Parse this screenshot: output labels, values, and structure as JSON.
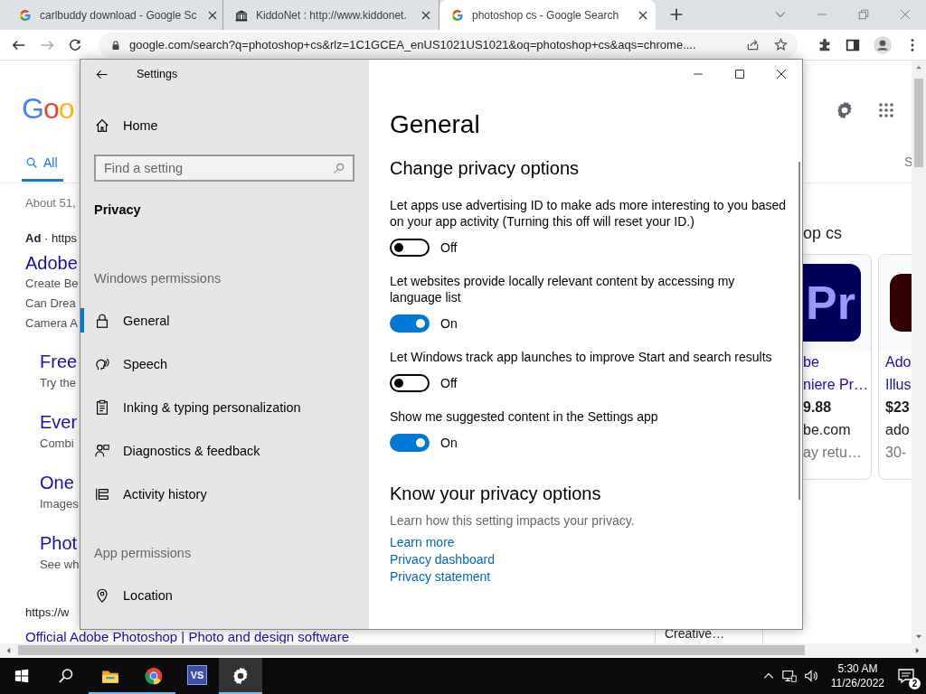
{
  "browser": {
    "tabs": [
      {
        "title": "carlbuddy download - Google Sc",
        "selected": false
      },
      {
        "title": "KiddoNet : http://www.kiddonet.",
        "selected": false
      },
      {
        "title": "photoshop cs - Google Search",
        "selected": true
      }
    ],
    "address": "google.com/search?q=photoshop+cs&rlz=1C1GCEA_enUS1021US1021&oq=photoshop+cs&aqs=chrome...."
  },
  "page": {
    "left": [
      {
        "kind": "logo",
        "text": "Goo"
      },
      {
        "kind": "tab",
        "text": "All",
        "selected": true
      },
      {
        "kind": "meta",
        "text": "About 51,"
      },
      {
        "kind": "ad",
        "text": "**Ad** · https"
      },
      {
        "kind": "title",
        "text": "Adobe"
      },
      {
        "kind": "snippet",
        "text": "Create Be"
      },
      {
        "kind": "snippet",
        "text": "Can Drea"
      },
      {
        "kind": "snippet",
        "text": "Camera A"
      },
      {
        "kind": "sitelink",
        "text": "Free"
      },
      {
        "kind": "sitedesc",
        "text": "Try the"
      },
      {
        "kind": "sitelink",
        "text": "Ever"
      },
      {
        "kind": "sitedesc",
        "text": "Combi"
      },
      {
        "kind": "sitelink",
        "text": "One"
      },
      {
        "kind": "sitedesc",
        "text": "Images"
      },
      {
        "kind": "sitelink",
        "text": "Phot"
      },
      {
        "kind": "sitedesc",
        "text": "See wh"
      },
      {
        "kind": "url",
        "text": "https://w"
      },
      {
        "kind": "result",
        "text": "Official Adobe Photoshop | Photo and design software"
      }
    ],
    "right": {
      "tab_fragment": "S",
      "section_title": "op cs",
      "cards": [
        {
          "icon_text": "Pr",
          "lines": [
            {
              "kind": "link",
              "text": "be"
            },
            {
              "kind": "link",
              "text": "niere Pr…"
            },
            {
              "kind": "price",
              "text": "9.88"
            },
            {
              "kind": "source",
              "text": "be.com"
            },
            {
              "kind": "note",
              "text": "ay retu…"
            }
          ]
        },
        {
          "lines": [
            {
              "kind": "link",
              "text": "Ado"
            },
            {
              "kind": "link",
              "text": "Illus"
            },
            {
              "kind": "price",
              "text": "$23"
            },
            {
              "kind": "source",
              "text": "ado"
            },
            {
              "kind": "note",
              "text": "30-"
            }
          ]
        }
      ]
    },
    "bottom_card": "Creative…"
  },
  "settings": {
    "title": "Settings",
    "home": "Home",
    "search_placeholder": "Find a setting",
    "section": "Privacy",
    "groups": [
      {
        "label": "Windows permissions",
        "items": [
          {
            "label": "General",
            "selected": true
          },
          {
            "label": "Speech",
            "selected": false
          },
          {
            "label": "Inking & typing personalization",
            "selected": false
          },
          {
            "label": "Diagnostics & feedback",
            "selected": false
          },
          {
            "label": "Activity history",
            "selected": false
          }
        ]
      },
      {
        "label": "App permissions",
        "items": [
          {
            "label": "Location",
            "selected": false
          }
        ]
      }
    ],
    "heading": "General",
    "subheading": "Change privacy options",
    "options": [
      {
        "text": "Let apps use advertising ID to make ads more interesting to you based on your app activity (Turning this off will reset your ID.)",
        "on": false,
        "state_label": "Off"
      },
      {
        "text": "Let websites provide locally relevant content by accessing my language list",
        "on": true,
        "state_label": "On"
      },
      {
        "text": "Let Windows track app launches to improve Start and search results",
        "on": false,
        "state_label": "Off"
      },
      {
        "text": "Show me suggested content in the Settings app",
        "on": true,
        "state_label": "On"
      }
    ],
    "know_heading": "Know your privacy options",
    "know_text": "Learn how this setting impacts your privacy.",
    "links": [
      "Learn more",
      "Privacy dashboard",
      "Privacy statement"
    ]
  },
  "taskbar": {
    "apps": [
      {
        "running": true,
        "active": false
      },
      {
        "running": true,
        "active": false
      },
      {
        "label": "VS",
        "running": false,
        "active": false
      },
      {
        "running": true,
        "active": true
      }
    ],
    "time": "5:30 AM",
    "date": "11/26/2022",
    "notifications": "2"
  }
}
